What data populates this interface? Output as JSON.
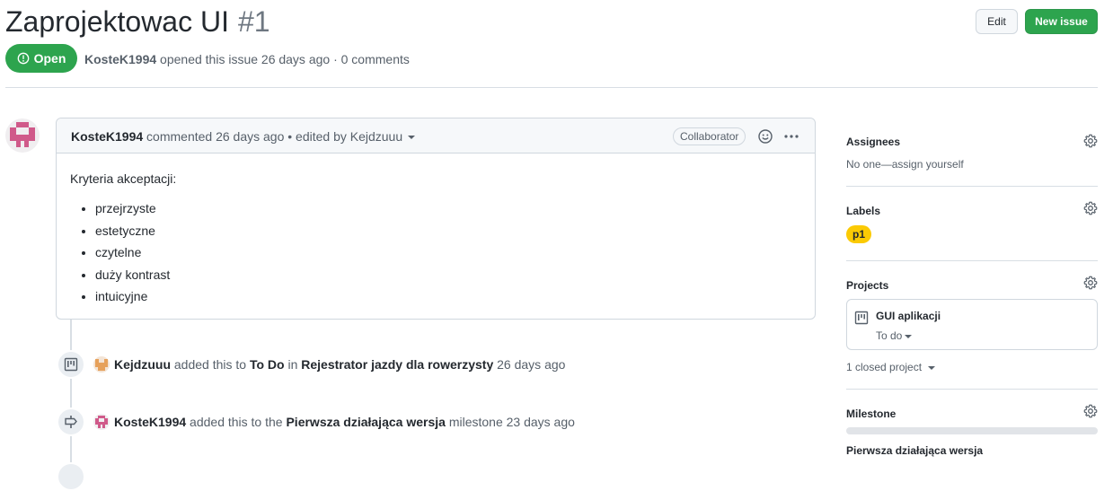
{
  "issue": {
    "title": "Zaprojektowac UI",
    "number": "#1",
    "state": "Open",
    "author": "KosteK1994",
    "meta_rest": "opened this issue 26 days ago · 0 comments"
  },
  "toolbar": {
    "edit_label": "Edit",
    "new_issue_label": "New issue"
  },
  "comment": {
    "author": "KosteK1994",
    "action": "commented 26 days ago • edited by Kejdzuuu",
    "role_badge": "Collaborator",
    "intro": "Kryteria akceptacji:",
    "items": [
      "przejrzyste",
      "estetyczne",
      "czytelne",
      "duży kontrast",
      "intuicyjne"
    ]
  },
  "timeline": [
    {
      "icon": "project-icon",
      "actor": "Kejdzuuu",
      "t1": "added this to",
      "target": "To Do",
      "t2": "in",
      "target2": "Rejestrator jazdy dla rowerzysty",
      "time": "26 days ago"
    },
    {
      "icon": "milestone-icon",
      "actor": "KosteK1994",
      "t1": "added this to the",
      "target": "Pierwsza działająca wersja",
      "t2": "milestone",
      "time": "23 days ago"
    }
  ],
  "sidebar": {
    "assignees": {
      "heading": "Assignees",
      "value": "No one—assign yourself"
    },
    "labels": {
      "heading": "Labels",
      "items": [
        {
          "name": "p1",
          "color": "#fbca04"
        }
      ]
    },
    "projects": {
      "heading": "Projects",
      "card_title": "GUI aplikacji",
      "card_column": "To do",
      "closed": "1 closed project"
    },
    "milestone": {
      "heading": "Milestone",
      "name": "Pierwsza działająca wersja",
      "progress": 0
    }
  },
  "colors": {
    "open_green": "#2da44e",
    "label_yellow": "#fbca04",
    "avatar_pink": "#d05a8a"
  }
}
